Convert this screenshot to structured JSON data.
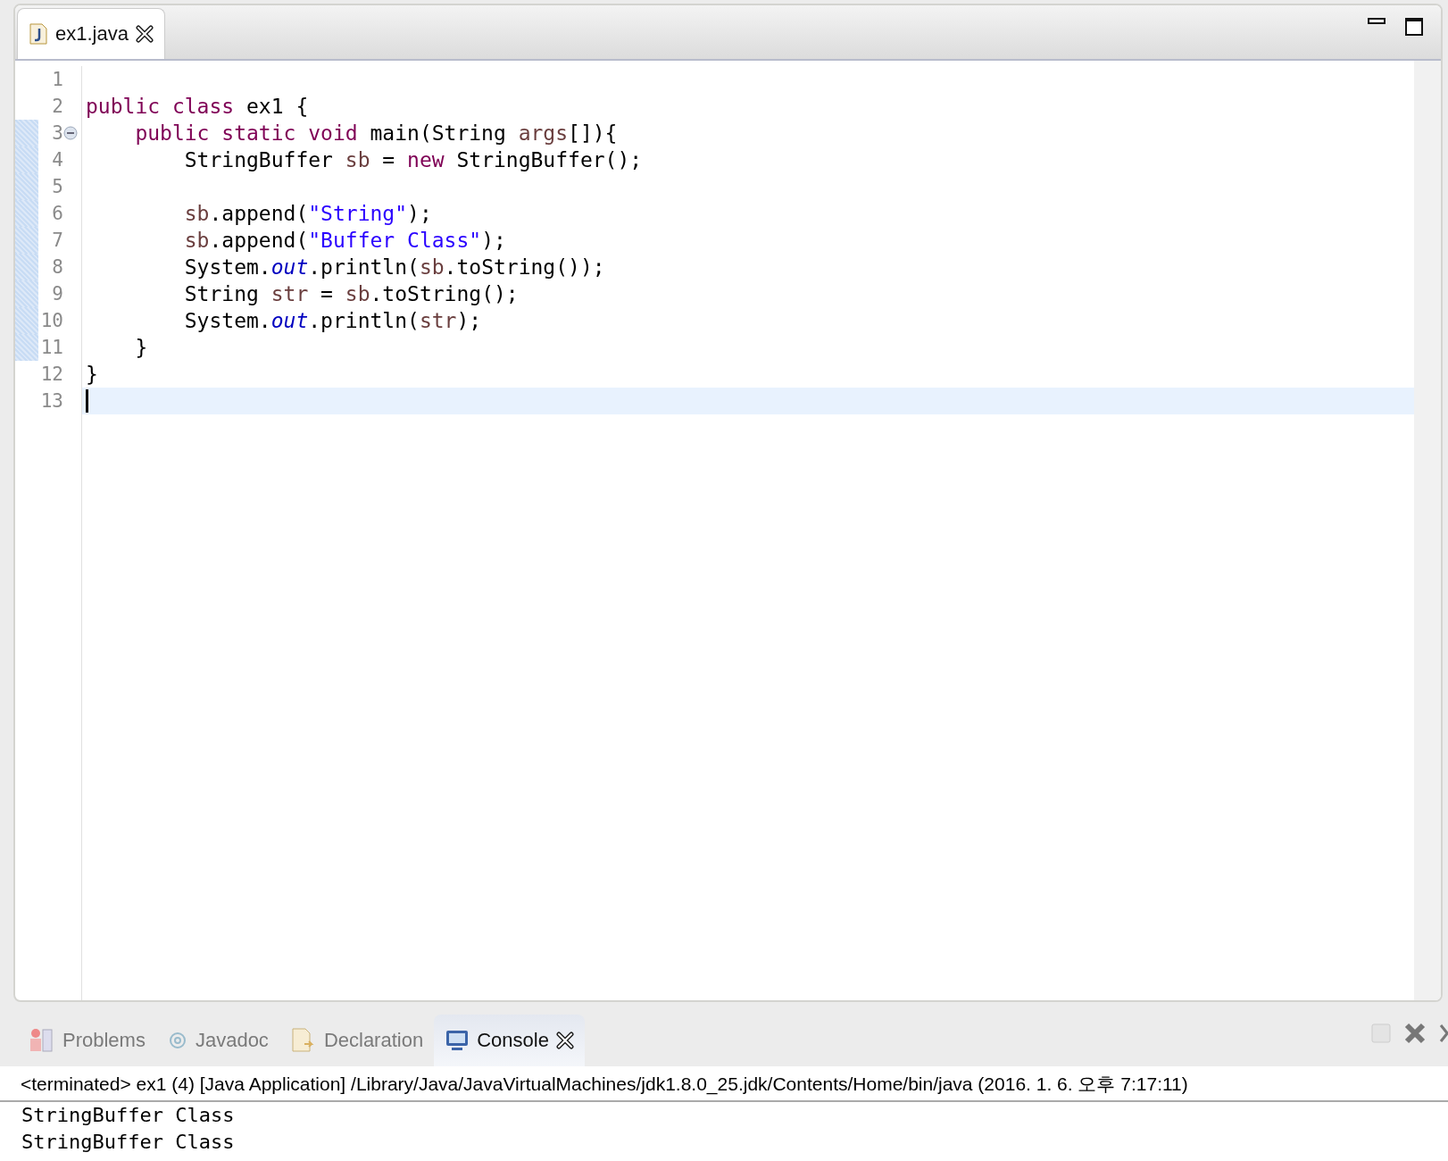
{
  "editor": {
    "tabs": [
      {
        "label": "ex1.java",
        "selected": true
      }
    ],
    "lines": [
      {
        "number": "1",
        "changed": false,
        "fold": false,
        "selected": false
      },
      {
        "number": "2",
        "changed": false,
        "fold": false,
        "selected": false,
        "tokens": [
          {
            "kind": "keyword",
            "text": "public class"
          },
          {
            "kind": "plain",
            "text": " ex1 {"
          }
        ]
      },
      {
        "number": "3",
        "changed": true,
        "fold": true,
        "selected": false,
        "tokens": [
          {
            "kind": "keyword",
            "text": "    public static void"
          },
          {
            "kind": "plain",
            "text": " main(String "
          },
          {
            "kind": "variable",
            "text": "args"
          },
          {
            "kind": "plain",
            "text": "[]){"
          }
        ]
      },
      {
        "number": "4",
        "changed": true,
        "fold": false,
        "selected": false,
        "tokens": [
          {
            "kind": "plain",
            "text": "        StringBuffer "
          },
          {
            "kind": "variable",
            "text": "sb"
          },
          {
            "kind": "plain",
            "text": " = "
          },
          {
            "kind": "keyword",
            "text": "new"
          },
          {
            "kind": "plain",
            "text": " StringBuffer();"
          }
        ]
      },
      {
        "number": "5",
        "changed": true,
        "fold": false,
        "selected": false
      },
      {
        "number": "6",
        "changed": true,
        "fold": false,
        "selected": false,
        "tokens": [
          {
            "kind": "variable",
            "text": "        sb"
          },
          {
            "kind": "plain",
            "text": ".append("
          },
          {
            "kind": "string",
            "text": "\"String\""
          },
          {
            "kind": "plain",
            "text": ");"
          }
        ]
      },
      {
        "number": "7",
        "changed": true,
        "fold": false,
        "selected": false,
        "tokens": [
          {
            "kind": "variable",
            "text": "        sb"
          },
          {
            "kind": "plain",
            "text": ".append("
          },
          {
            "kind": "string",
            "text": "\"Buffer Class\""
          },
          {
            "kind": "plain",
            "text": ");"
          }
        ]
      },
      {
        "number": "8",
        "changed": true,
        "fold": false,
        "selected": false,
        "tokens": [
          {
            "kind": "plain",
            "text": "        System."
          },
          {
            "kind": "static",
            "text": "out"
          },
          {
            "kind": "plain",
            "text": ".println("
          },
          {
            "kind": "variable",
            "text": "sb"
          },
          {
            "kind": "plain",
            "text": ".toString());"
          }
        ]
      },
      {
        "number": "9",
        "changed": true,
        "fold": false,
        "selected": false,
        "tokens": [
          {
            "kind": "plain",
            "text": "        String "
          },
          {
            "kind": "variable",
            "text": "str"
          },
          {
            "kind": "plain",
            "text": " = "
          },
          {
            "kind": "variable",
            "text": "sb"
          },
          {
            "kind": "plain",
            "text": ".toString();"
          }
        ]
      },
      {
        "number": "10",
        "changed": true,
        "fold": false,
        "selected": false,
        "tokens": [
          {
            "kind": "plain",
            "text": "        System."
          },
          {
            "kind": "static",
            "text": "out"
          },
          {
            "kind": "plain",
            "text": ".println("
          },
          {
            "kind": "variable",
            "text": "str"
          },
          {
            "kind": "plain",
            "text": ");"
          }
        ]
      },
      {
        "number": "11",
        "changed": true,
        "fold": false,
        "selected": false,
        "tokens": [
          {
            "kind": "plain",
            "text": "    }"
          }
        ]
      },
      {
        "number": "12",
        "changed": false,
        "fold": false,
        "selected": false,
        "tokens": [
          {
            "kind": "plain",
            "text": "}"
          }
        ]
      },
      {
        "number": "13",
        "changed": false,
        "fold": false,
        "selected": true
      }
    ]
  },
  "bottom_panel": {
    "tabs": [
      {
        "label": "Problems",
        "selected": false,
        "kind": "problems"
      },
      {
        "label": "Javadoc",
        "selected": false,
        "kind": "javadoc"
      },
      {
        "label": "Declaration",
        "selected": false,
        "kind": "declaration"
      },
      {
        "label": "Console",
        "selected": true,
        "kind": "console"
      }
    ],
    "console": {
      "header": "<terminated> ex1 (4) [Java Application] /Library/Java/JavaVirtualMachines/jdk1.8.0_25.jdk/Contents/Home/bin/java (2016. 1. 6. 오후 7:17:11)",
      "output": [
        "StringBuffer Class",
        "StringBuffer Class"
      ]
    }
  }
}
